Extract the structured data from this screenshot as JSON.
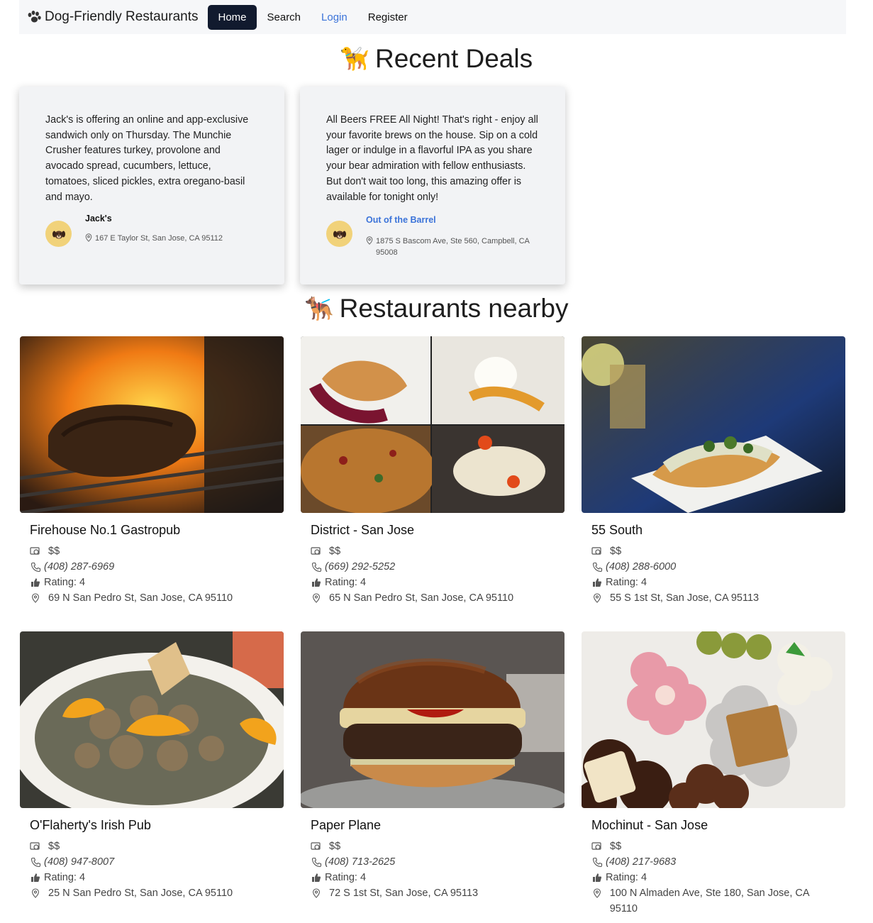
{
  "nav": {
    "brand": "Dog-Friendly Restaurants",
    "links": [
      "Home",
      "Search",
      "Login",
      "Register"
    ],
    "active": "Home"
  },
  "deals": {
    "title": "Recent Deals",
    "title_emoji": "🦮",
    "items": [
      {
        "text": "Jack's is offering an online and app-exclusive sandwich only on Thursday. The Munchie Crusher features turkey, provolone and avocado spread, cucumbers, lettuce, tomatoes, sliced pickles, extra oregano-basil and mayo.",
        "restaurant": "Jack's",
        "address": "167 E Taylor St, San Jose, CA 95112",
        "avatar_icon": "dog-avatar-icon"
      },
      {
        "text": "All Beers FREE All Night! That's right - enjoy all your favorite brews on the house. Sip on a cold lager or indulge in a flavorful IPA as you share your bear admiration with fellow enthusiasts. But don't wait too long, this amazing offer is available for tonight only!",
        "restaurant": "Out of the Barrel",
        "address": "1875 S Bascom Ave, Ste 560, Campbell, CA 95008",
        "avatar_icon": "dog-avatar-icon"
      }
    ]
  },
  "nearby": {
    "title": "Restaurants nearby",
    "title_emoji": "🐕‍🦺",
    "restaurants": [
      {
        "name": "Firehouse No.1 Gastropub",
        "price": "$$",
        "phone": "(408) 287-6969",
        "rating": "Rating: 4",
        "address": "69 N San Pedro St, San Jose, CA 95110"
      },
      {
        "name": "District - San Jose",
        "price": "$$",
        "phone": "(669) 292-5252",
        "rating": "Rating: 4",
        "address": "65 N San Pedro St, San Jose, CA 95110"
      },
      {
        "name": "55 South",
        "price": "$$",
        "phone": "(408) 288-6000",
        "rating": "Rating: 4",
        "address": "55 S 1st St, San Jose, CA 95113"
      },
      {
        "name": "O'Flaherty's Irish Pub",
        "price": "$$",
        "phone": "(408) 947-8007",
        "rating": "Rating: 4",
        "address": "25 N San Pedro St, San Jose, CA 95110"
      },
      {
        "name": "Paper Plane",
        "price": "$$",
        "phone": "(408) 713-2625",
        "rating": "Rating: 4",
        "address": "72 S 1st St, San Jose, CA 95113"
      },
      {
        "name": "Mochinut - San Jose",
        "price": "$$",
        "phone": "(408) 217-9683",
        "rating": "Rating: 4",
        "address": "100 N Almaden Ave, Ste 180, San Jose, CA 95110"
      }
    ]
  },
  "colors": {
    "active_nav": "#111a2e",
    "link": "#3b73d9",
    "avatar": "#f1d27a",
    "navbar_bg": "#f6f7f9"
  }
}
